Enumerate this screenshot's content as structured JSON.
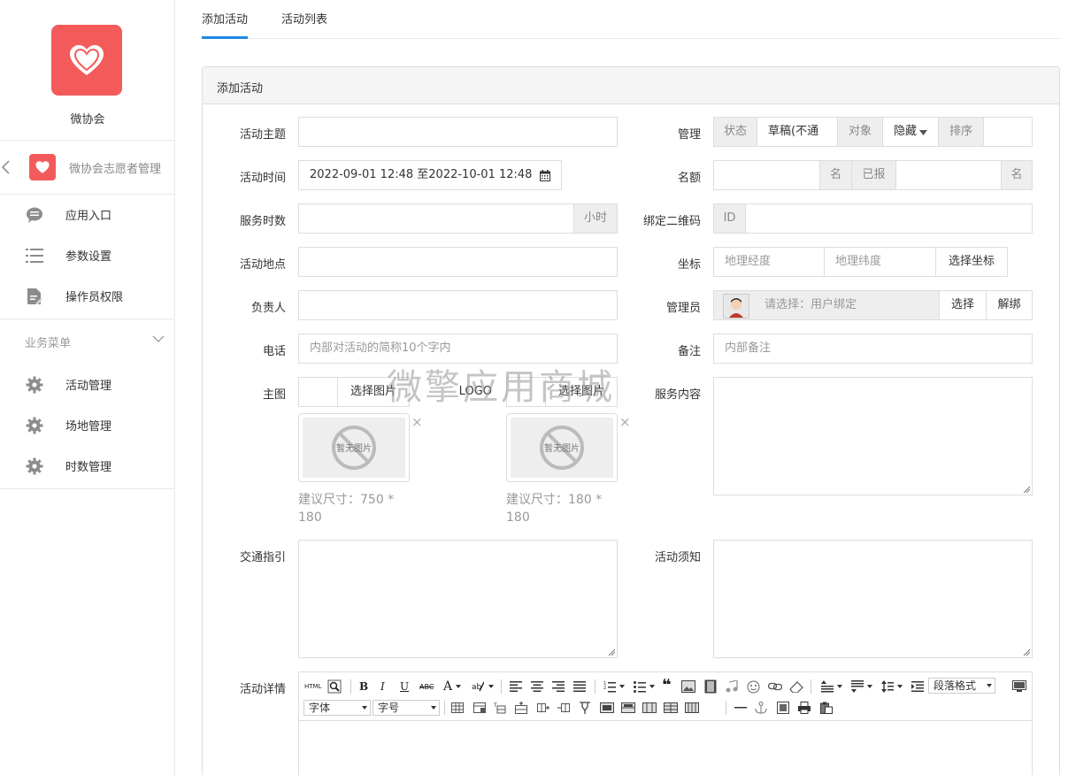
{
  "sidebar": {
    "app_name": "微协会",
    "module_name": "微协会志愿者管理",
    "items": [
      {
        "label": "应用入口",
        "icon": "chat-bubble-icon"
      },
      {
        "label": "参数设置",
        "icon": "list-icon"
      },
      {
        "label": "操作员权限",
        "icon": "document-edit-icon"
      }
    ],
    "section_title": "业务菜单",
    "business_items": [
      {
        "label": "活动管理",
        "icon": "gear-icon"
      },
      {
        "label": "场地管理",
        "icon": "gear-icon"
      },
      {
        "label": "时数管理",
        "icon": "gear-icon"
      }
    ]
  },
  "tabs": [
    {
      "label": "添加活动",
      "active": true
    },
    {
      "label": "活动列表",
      "active": false
    }
  ],
  "panel": {
    "title": "添加活动"
  },
  "form": {
    "theme_label": "活动主题",
    "time_label": "活动时间",
    "time_value": "2022-09-01 12:48 至2022-10-01 12:48",
    "hours_label": "服务时数",
    "hours_unit": "小时",
    "location_label": "活动地点",
    "leader_label": "负责人",
    "phone_label": "电话",
    "phone_placeholder": "内部对活动的简称10个字内",
    "main_image_label": "主图",
    "choose_image": "选择图片",
    "logo_label": "LOGO",
    "no_image_text": "暂无图片",
    "hint_main": "建议尺寸：750 * 180",
    "hint_logo": "建议尺寸：180 * 180",
    "traffic_label": "交通指引",
    "manage_label": "管理",
    "status_label": "状态",
    "status_value": "草稿(不通",
    "target_label": "对象",
    "target_value": "隐藏",
    "sort_label": "排序",
    "quota_label": "名额",
    "quota_unit": "名",
    "reported_label": "已报",
    "reported_unit": "名",
    "qrcode_label": "绑定二维码",
    "qrcode_id": "ID",
    "coord_label": "坐标",
    "lng_placeholder": "地理经度",
    "lat_placeholder": "地理纬度",
    "choose_coord": "选择坐标",
    "admin_label": "管理员",
    "admin_placeholder": "请选择：用户绑定",
    "select_btn": "选择",
    "unbind_btn": "解绑",
    "note_label": "备注",
    "note_placeholder": "内部备注",
    "service_label": "服务内容",
    "notice_label": "活动须知",
    "detail_label": "活动详情"
  },
  "editor": {
    "html_btn": "HTML",
    "bold": "B",
    "italic": "I",
    "underline": "U",
    "strike": "ABC",
    "fontcolor": "A",
    "paragraph": "段落格式",
    "font_family": "字体",
    "font_size": "字号"
  },
  "watermark": "微擎应用商城",
  "colors": {
    "accent": "#1e88e5",
    "brand": "#f35b5b"
  }
}
